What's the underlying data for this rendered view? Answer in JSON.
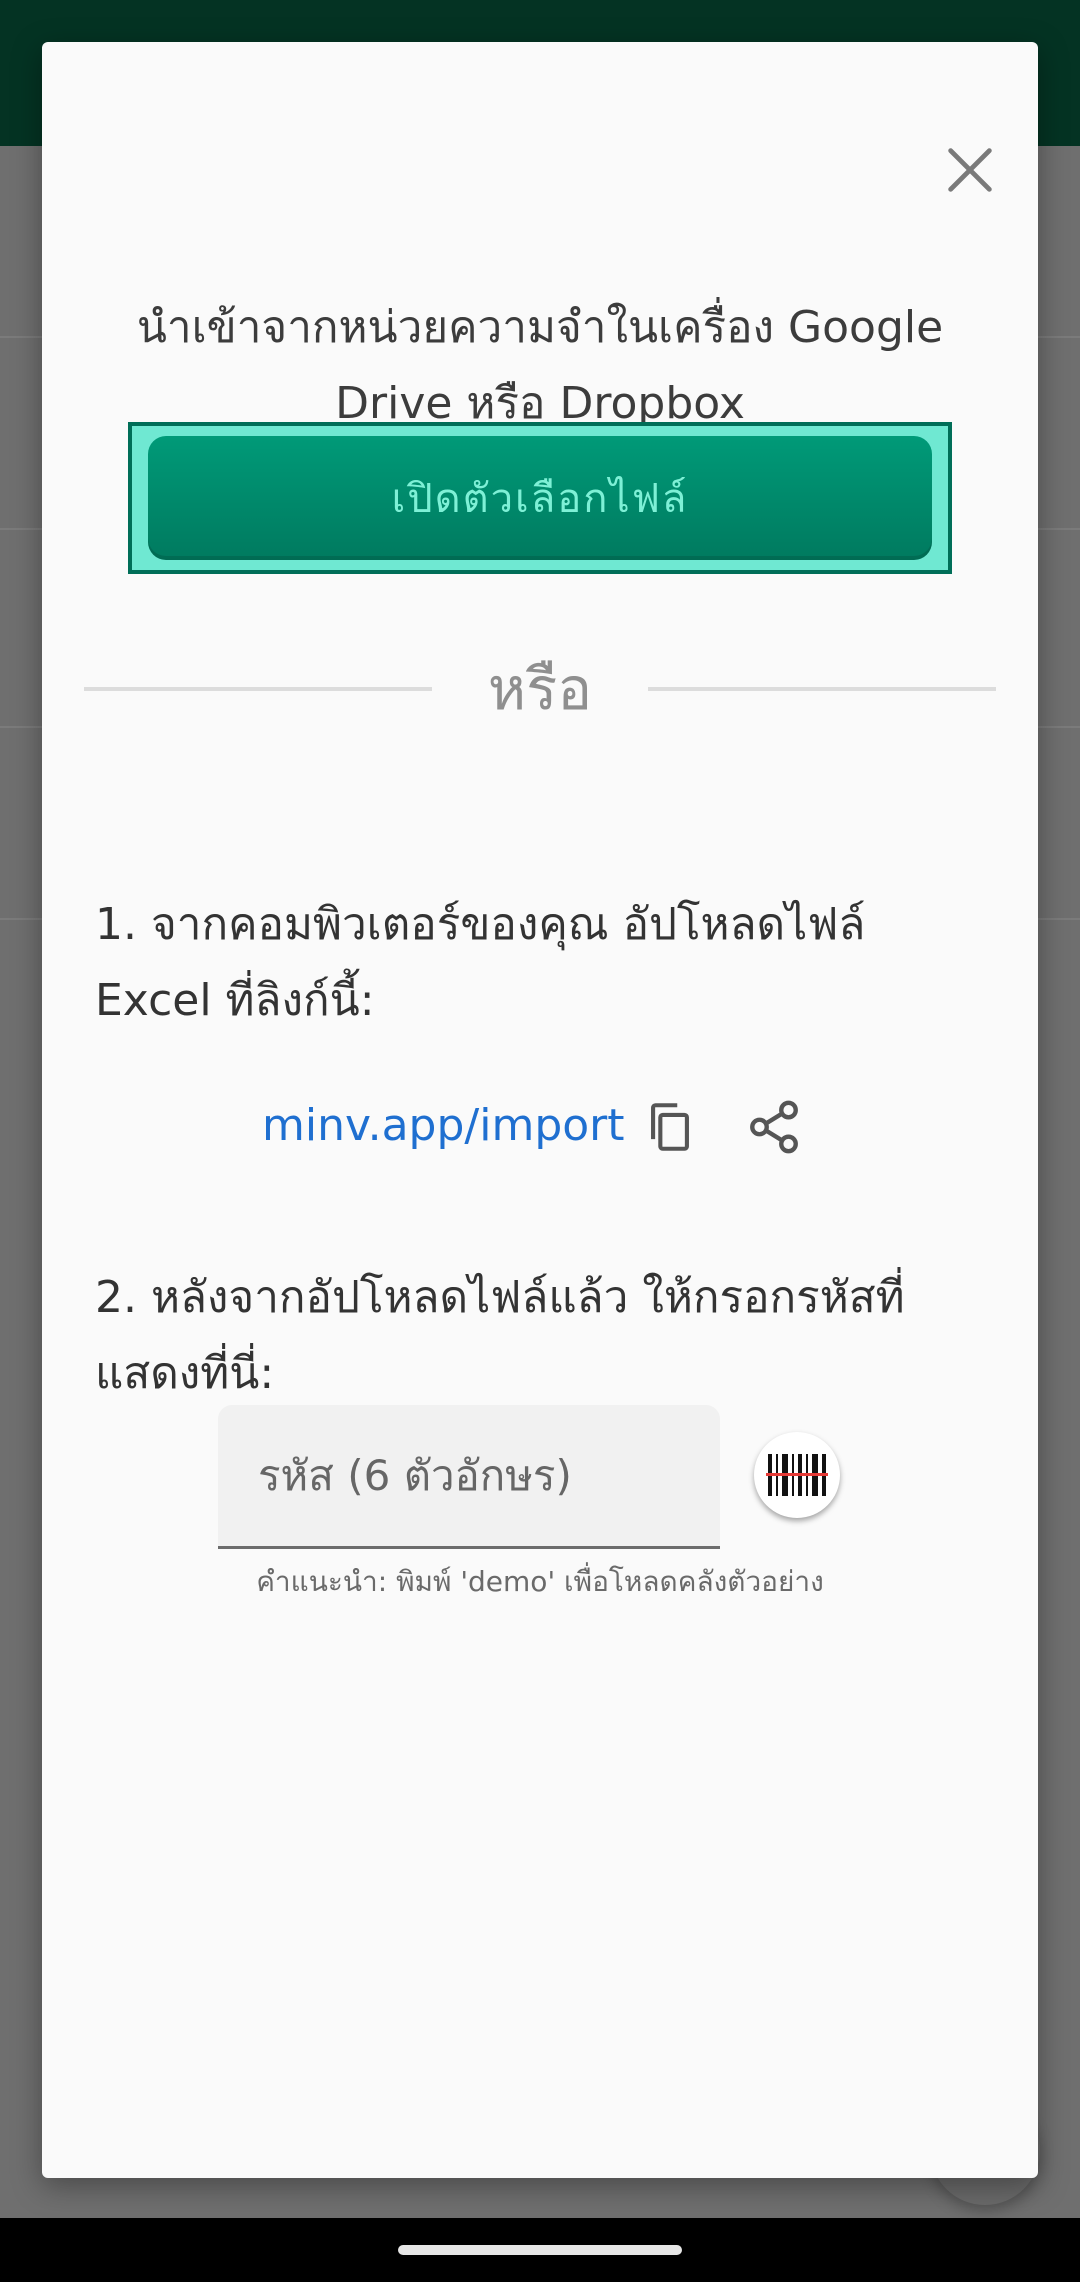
{
  "dialog": {
    "intro_text": "นำเข้าจากหน่วยความจำในเครื่อง Google Drive หรือ Dropbox",
    "open_file_label": "เปิดตัวเลือกไฟล์",
    "or_text": "หรือ",
    "step1": "1. จากคอมพิวเตอร์ของคุณ อัปโหลดไฟล์ Excel ที่ลิงก์นี้:",
    "import_link": "minv.app/import",
    "step2": "2. หลังจากอัปโหลดไฟล์แล้ว ให้กรอกรหัสที่แสดงที่นี่:",
    "code_placeholder": "รหัส (6 ตัวอักษร)",
    "hint": "คำแนะนำ: พิมพ์ 'demo' เพื่อโหลดคลังตัวอย่าง"
  },
  "icons": {
    "close": "close-icon",
    "copy": "copy-icon",
    "share": "share-icon",
    "barcode": "barcode-scan-icon"
  },
  "colors": {
    "header": "#043323",
    "button": "#008a6b",
    "button_text": "#7ef0d6",
    "link": "#1f6fd0"
  }
}
